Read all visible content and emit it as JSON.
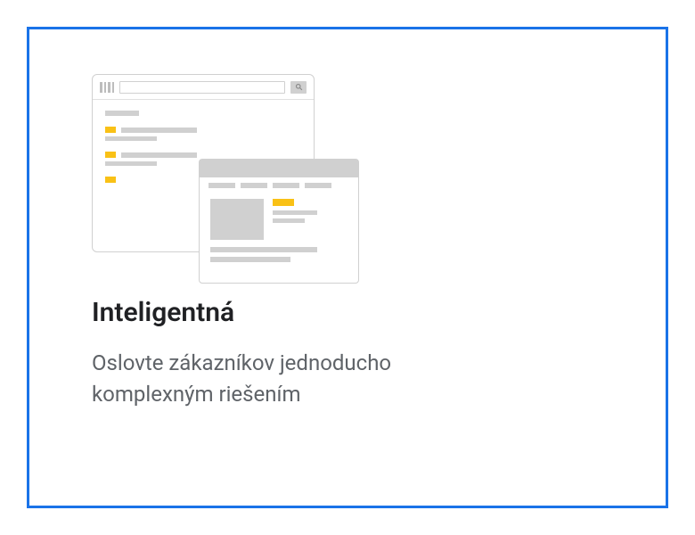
{
  "card": {
    "title": "Inteligentná",
    "description": "Oslovte zákazníkov jednoducho komplexným riešením"
  },
  "colors": {
    "accent": "#1a73e8",
    "highlight": "#f9c116",
    "neutral": "#d0d0d0"
  }
}
